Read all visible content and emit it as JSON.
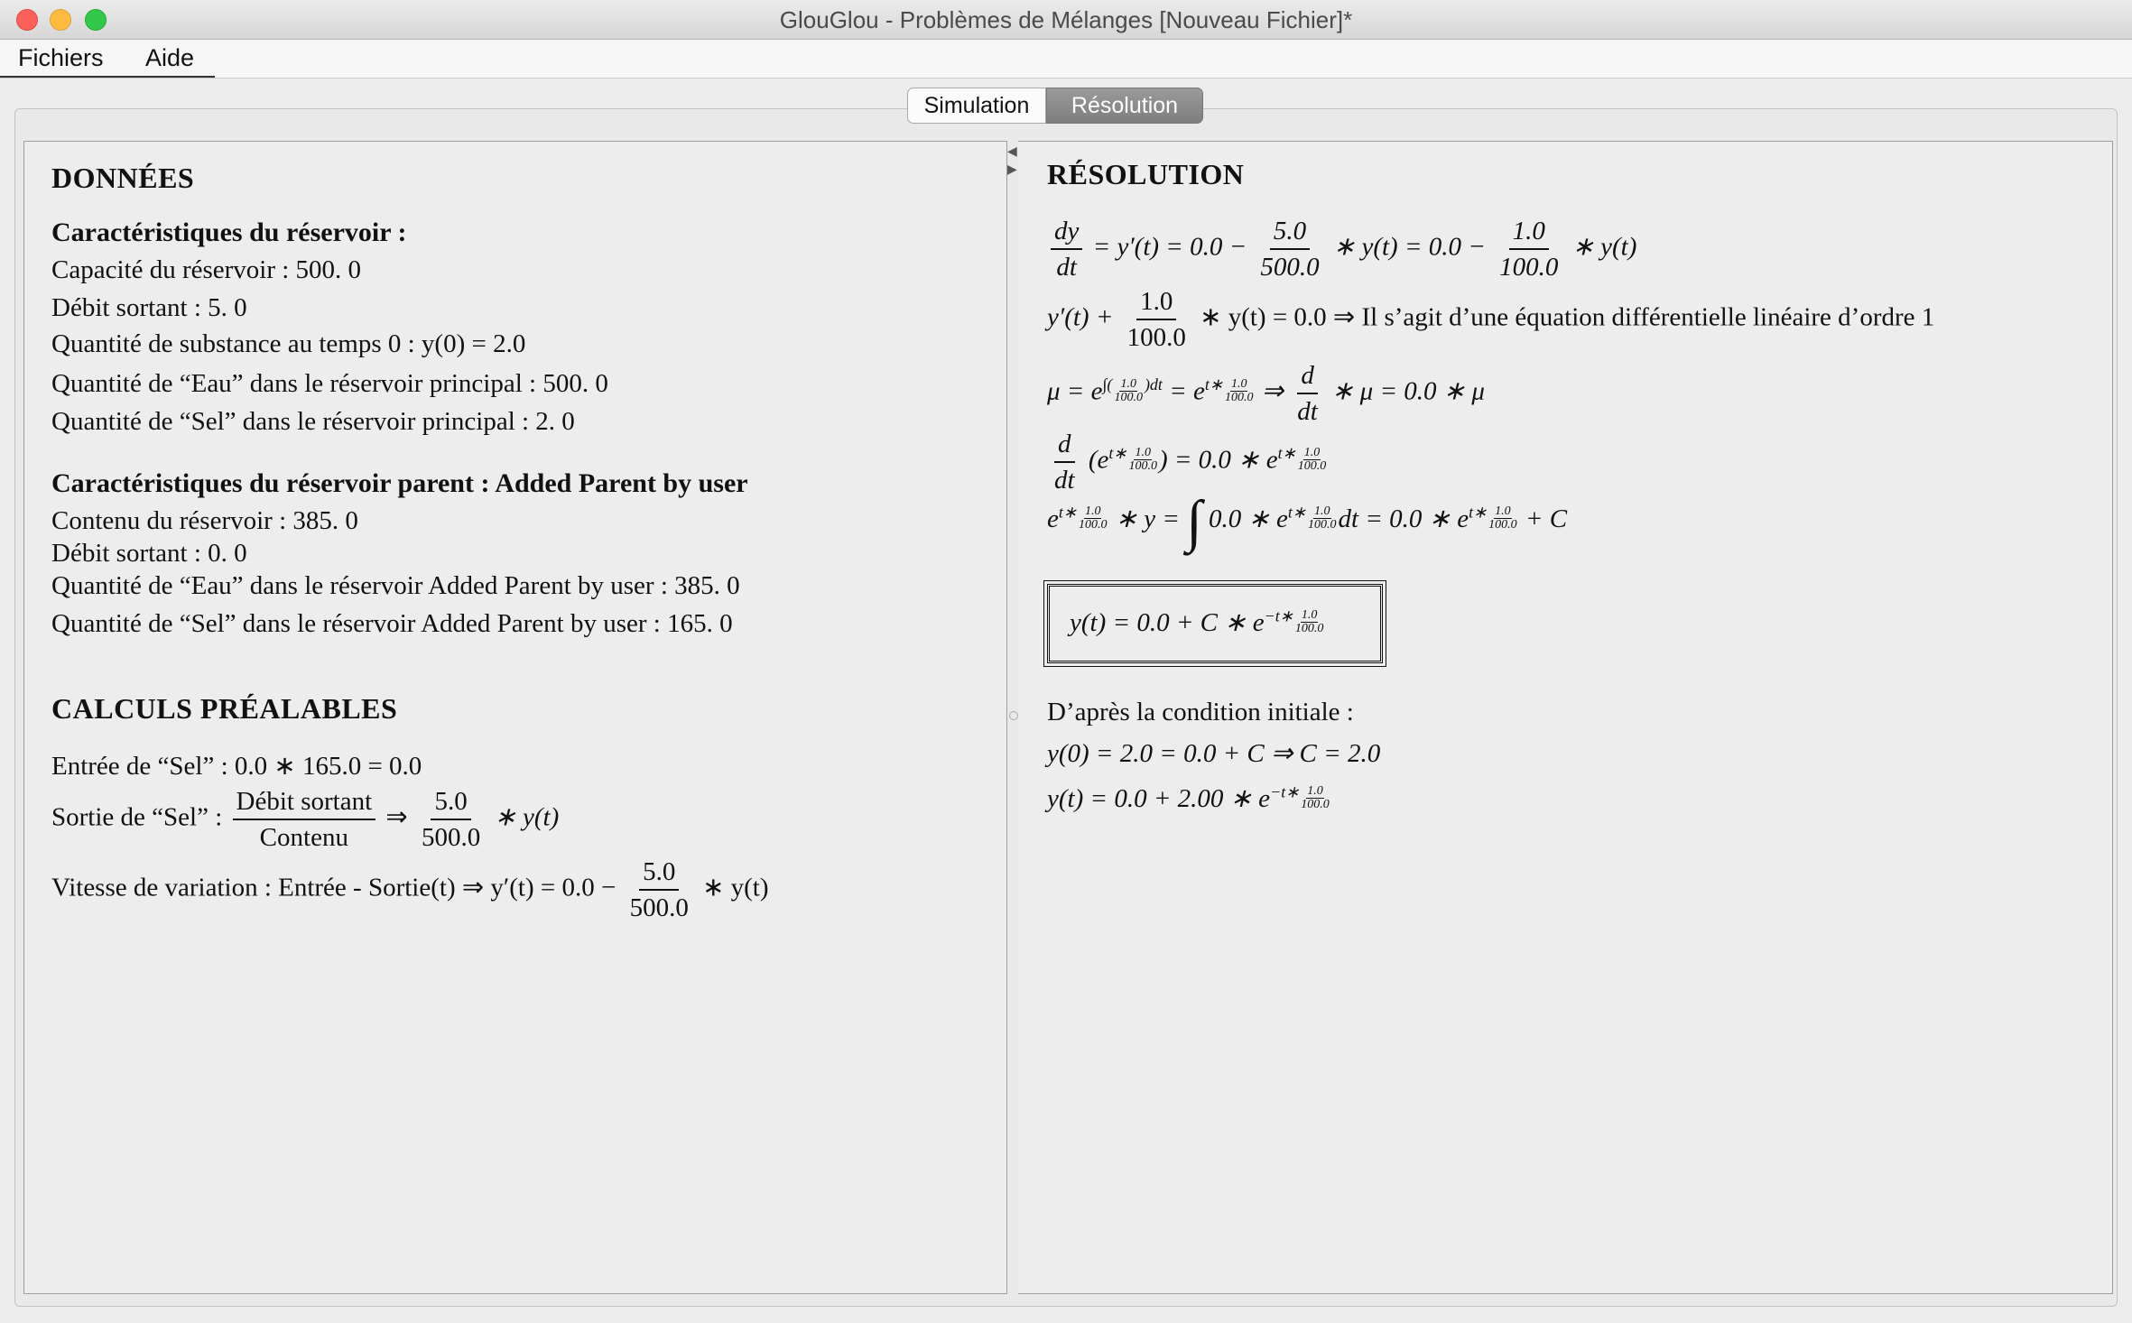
{
  "window": {
    "title": "GlouGlou - Problèmes de Mélanges [Nouveau Fichier]*"
  },
  "menu": {
    "files": "Fichiers",
    "help": "Aide"
  },
  "tabs": {
    "simulation": "Simulation",
    "resolution": "Résolution"
  },
  "donnees": {
    "heading": "DONNÉES",
    "tank_heading": "Caractéristiques du réservoir :",
    "capacity": "Capacité du réservoir : 500. 0",
    "outflow": "Débit sortant :  5. 0",
    "substance_t0": "Quantité de substance au temps 0 :  y(0) = 2.0",
    "water_main": "Quantité de “Eau” dans le réservoir principal :  500. 0",
    "salt_main": "Quantité de “Sel” dans le réservoir principal :  2. 0",
    "parent_heading": "Caractéristiques du réservoir parent :  Added Parent by user",
    "parent_content": "Contenu du réservoir : 385. 0",
    "parent_outflow": "Débit sortant :  0. 0",
    "parent_water": "Quantité de “Eau” dans le réservoir Added Parent by user :  385. 0",
    "parent_salt": "Quantité de “Sel” dans le réservoir Added Parent by user :  165. 0"
  },
  "calculs": {
    "heading": "CALCULS PRÉALABLES",
    "entry": "Entrée de “Sel” :  0.0 ∗ 165.0 = 0.0",
    "exit_label": "Sortie de “Sel” :",
    "exit_num": "Débit sortant",
    "exit_den": "Contenu",
    "exit_frac_num": "5.0",
    "exit_frac_den": "500.0",
    "rate_label": "Vitesse de variation :  Entrée - Sortie(t) ⇒ y′(t) = 0.0 −",
    "rate_frac_num": "5.0",
    "rate_frac_den": "500.0",
    "rate_tail": "∗ y(t)"
  },
  "resolution": {
    "heading": "RÉSOLUTION",
    "eq1_a_num": "dy",
    "eq1_a_den": "dt",
    "eq1_mid": "= y′(t) = 0.0 −",
    "eq1_b_num": "5.0",
    "eq1_b_den": "500.0",
    "eq1_mid2": "∗ y(t) = 0.0 −",
    "eq1_c_num": "1.0",
    "eq1_c_den": "100.0",
    "eq1_tail": "∗ y(t)",
    "eq2_head": "y′(t) +",
    "eq2_num": "1.0",
    "eq2_den": "100.0",
    "eq2_tail": "∗ y(t) = 0.0 ⇒ Il s’agit d’une équation différentielle linéaire d’ordre 1",
    "eq3_head": "μ = e",
    "eq3_sup1": "∫(",
    "eq3_sup_num": "1.0",
    "eq3_sup_den": "100.0",
    "eq3_sup2": ")dt",
    "eq3_mid": "= e",
    "eq3_sup3": "t∗",
    "eq3_arrow": "⇒",
    "eq3_d_num": "d",
    "eq3_d_den": "dt",
    "eq3_tail": "∗ μ = 0.0 ∗ μ",
    "eq4_d_num": "d",
    "eq4_d_den": "dt",
    "eq4_a": "(e",
    "eq4_sup": "t∗",
    "eq4_b": ") = 0.0 ∗ e",
    "eq5_a": "e",
    "eq5_sup": "t∗",
    "eq5_b": "∗ y =",
    "eq5_int": "∫",
    "eq5_c": "0.0 ∗ e",
    "eq5_d": "dt = 0.0 ∗ e",
    "eq5_e": "+ C",
    "solution": "y(t) = 0.0 + C ∗ e",
    "solution_sup": "−t∗",
    "initial_label": "D’après la condition initiale  :",
    "initial_eq": "y(0) = 2.0 = 0.0 + C ⇒ C = 2.0",
    "final_eq": "y(t) = 0.0 + 2.00 ∗ e",
    "final_sup": "−t∗",
    "mini_num": "1.0",
    "mini_den": "100.0"
  }
}
